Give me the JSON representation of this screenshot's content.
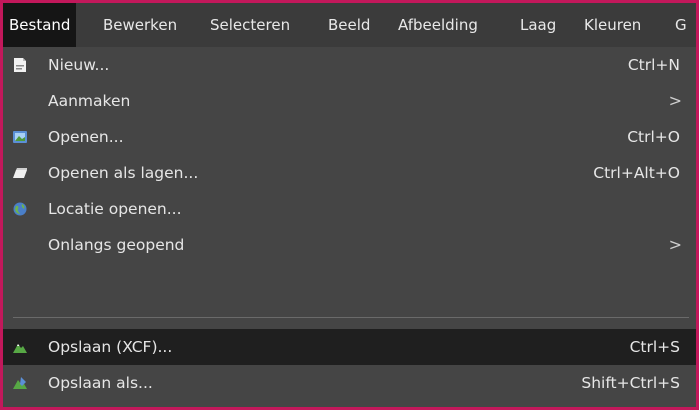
{
  "menubar": {
    "items": [
      "Bestand",
      "Bewerken",
      "Selecteren",
      "Beeld",
      "Afbeelding",
      "Laag",
      "Kleuren",
      "G"
    ]
  },
  "file_menu": {
    "items": [
      {
        "label": "Nieuw...",
        "shortcut": "Ctrl+N",
        "icon": "new-image-icon"
      },
      {
        "label": "Aanmaken",
        "submenu": ">"
      },
      {
        "label": "Openen...",
        "shortcut": "Ctrl+O",
        "icon": "open-image-icon"
      },
      {
        "label": "Openen als lagen...",
        "shortcut": "Ctrl+Alt+O",
        "icon": "open-as-layers-icon"
      },
      {
        "label": "Locatie openen...",
        "icon": "open-location-icon"
      },
      {
        "label": "Onlangs geopend",
        "submenu": ">"
      },
      {
        "label": "Opslaan (XCF)...",
        "shortcut": "Ctrl+S",
        "icon": "save-icon"
      },
      {
        "label": "Opslaan als...",
        "shortcut": "Shift+Ctrl+S",
        "icon": "save-as-icon"
      }
    ]
  },
  "colors": {
    "border": "#c2185b",
    "menu_bg": "#454545",
    "menubar_bg": "#3b3b3b",
    "active_bg": "#151515",
    "highlight_bg": "#1f1f1f"
  }
}
